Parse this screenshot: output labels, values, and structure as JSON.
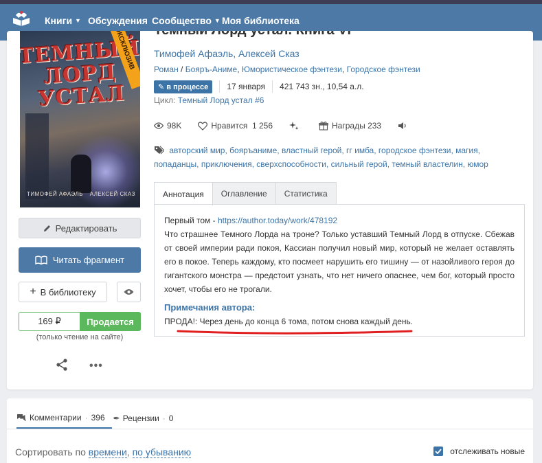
{
  "nav": {
    "items": [
      "Книги",
      "Обсуждения",
      "Сообщество",
      "Моя библиотека"
    ]
  },
  "cover": {
    "title_art": "ТЕМНЫЙ ЛОРД УСТАЛ",
    "ribbon": "ЭКСКЛЮЗИВ",
    "author_left": "ТИМОФЕЙ АФАЭЛЬ",
    "author_right": "АЛЕКСЕЙ СКАЗ"
  },
  "book": {
    "title": "Темный Лорд устал. Книга VI",
    "authors": "Тимофей Афаэль, Алексей Сказ",
    "genres": [
      "Роман",
      "Бояръ-Аниме",
      "Юмористическое фэнтези",
      "Городское фэнтези"
    ],
    "status_badge": "в процессе",
    "date": "17 января",
    "size": "421 743 зн., 10,54 а.л.",
    "cycle_label": "Цикл:",
    "cycle_name": "Темный Лорд устал",
    "cycle_number": "#6"
  },
  "stats": {
    "views": "98K",
    "likes_label": "Нравится",
    "likes": "1 256",
    "awards_label": "Награды",
    "awards": "233"
  },
  "tags": [
    "авторский мир",
    "бояръаниме",
    "властный герой",
    "гг имба",
    "городское фэнтези",
    "магия",
    "попаданцы",
    "приключения",
    "сверхспособности",
    "сильный герой",
    "темный властелин",
    "юмор"
  ],
  "tabs": [
    "Аннотация",
    "Оглавление",
    "Статистика"
  ],
  "annotation": {
    "first_volume_label": "Первый том - ",
    "first_volume_link": "https://author.today/work/478192",
    "text": "Что страшнее Темного Лорда на троне? Только уставший Темный Лорд в отпуске. Сбежав от своей империи ради покоя, Кассиан получил новый мир, который не желает оставлять его в покое. Теперь каждому, кто посмеет нарушить его тишину — от назойливого героя до гигантского монстра — предстоит узнать, что нет ничего опаснее, чем бог, который просто хочет, чтобы его не трогали.",
    "notes_title": "Примечания автора:",
    "notes_text": "ПРОДА!: Через день до конца 6 тома, потом снова каждый день."
  },
  "actions": {
    "edit": "Редактировать",
    "read": "Читать фрагмент",
    "library": "В библиотеку",
    "price": "169 ₽",
    "buy": "Продается",
    "price_note": "(только чтение на сайте)"
  },
  "comments": {
    "comments_label": "Комментарии",
    "comments_count": "396",
    "reviews_label": "Рецензии",
    "reviews_count": "0",
    "sort_prefix": "Сортировать по ",
    "sort_field": "времени",
    "sort_sep": ", ",
    "sort_order": "по убыванию",
    "follow_label": "отслеживать новые"
  },
  "colors": {
    "nav": "#4d79a6",
    "link": "#3c74a8",
    "buy": "#5cb85c",
    "ribbon": "#f5a21b",
    "underline": "#e02020"
  }
}
